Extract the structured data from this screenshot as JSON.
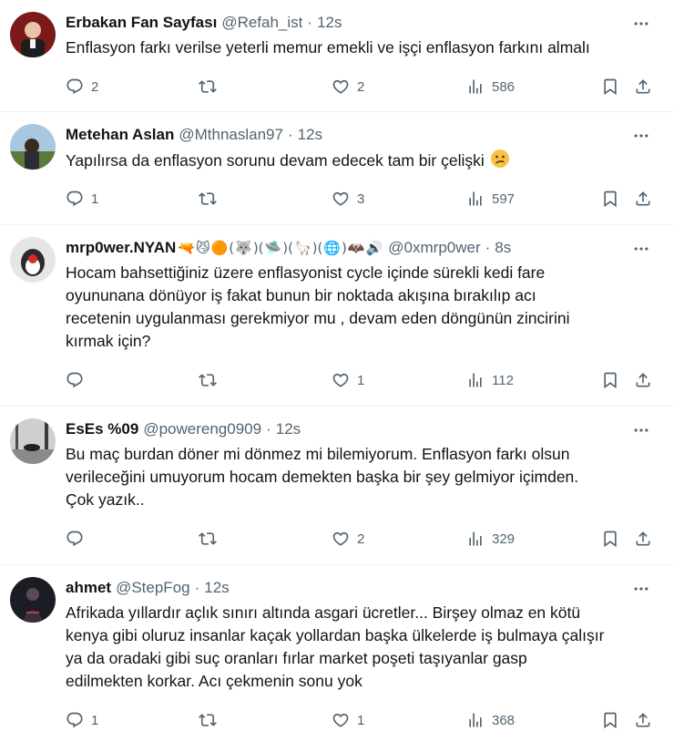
{
  "colors": {
    "text": "#0f1419",
    "muted": "#536471",
    "divider": "#eff3f4"
  },
  "icons": {
    "more": "more-icon",
    "reply": "reply-icon",
    "retweet": "retweet-icon",
    "like": "heart-icon",
    "views": "views-icon",
    "bookmark": "bookmark-icon",
    "share": "share-icon"
  },
  "tweets": [
    {
      "name": "Erbakan Fan Sayfası",
      "handle": "@Refah_ist",
      "dot": "·",
      "time": "12s",
      "text": "Enflasyon farkı verilse yeterli memur emekli ve işçi enflasyon farkını almalı",
      "replies": "2",
      "retweets": "",
      "likes": "2",
      "views": "586"
    },
    {
      "name": "Metehan Aslan",
      "handle": "@Mthnaslan97",
      "dot": "·",
      "time": "12s",
      "text": "Yapılırsa da enflasyon sorunu devam edecek tam bir çelişki",
      "emoji": "confused-face",
      "replies": "1",
      "retweets": "",
      "likes": "3",
      "views": "597"
    },
    {
      "name": "mrp0wer.NYAN",
      "name_emojis": [
        "🔫",
        "😼",
        "🟠",
        "(",
        "🐺",
        ")(",
        "🛸",
        ")(",
        "🦙",
        ")(",
        "🌐",
        ")",
        "🦇",
        "🔊"
      ],
      "handle": "@0xmrp0wer",
      "dot": "·",
      "time": "8s",
      "text": "Hocam bahsettiğiniz üzere enflasyonist cycle içinde sürekli kedi fare\noyununana dönüyor iş fakat bunun bir noktada akışına bırakılıp acı\nrecetenin uygulanması gerekmiyor mu , devam eden döngünün zincirini\nkırmak için?",
      "replies": "",
      "retweets": "",
      "likes": "1",
      "views": "112"
    },
    {
      "name": "EsEs %09",
      "handle": "@powereng0909",
      "dot": "·",
      "time": "12s",
      "text": "Bu maç burdan döner mi dönmez mi bilemiyorum. Enflasyon farkı olsun\nverileceğini umuyorum hocam demekten başka bir şey gelmiyor içimden.\nÇok yazık..",
      "replies": "",
      "retweets": "",
      "likes": "2",
      "views": "329"
    },
    {
      "name": "ahmet",
      "handle": "@StepFog",
      "dot": "·",
      "time": "12s",
      "text": "Afrikada yıllardır açlık sınırı altında asgari ücretler... Birşey olmaz en kötü\nkenya gibi oluruz insanlar kaçak yollardan başka ülkelerde iş bulmaya çalışır\nya da oradaki gibi suç oranları fırlar market poşeti taşıyanlar gasp\nedilmekten korkar. Acı çekmenin sonu yok",
      "replies": "1",
      "retweets": "",
      "likes": "1",
      "views": "368"
    }
  ]
}
